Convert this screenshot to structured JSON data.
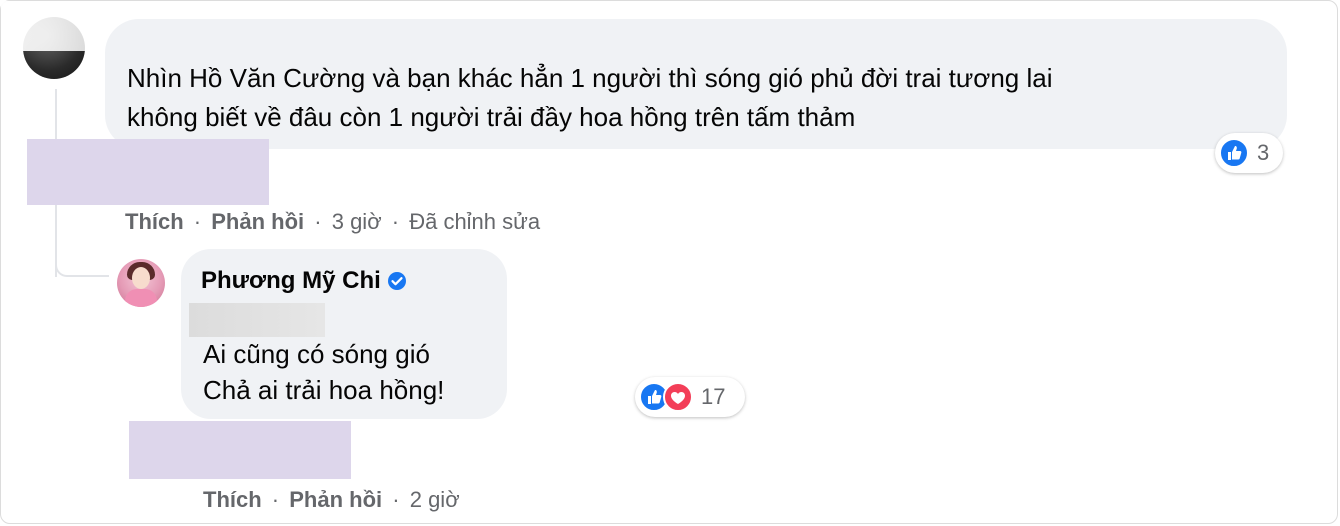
{
  "comment1": {
    "text_line1": "Nhìn Hồ Văn Cường và bạn khác hẳn 1 người thì sóng gió phủ đời trai tương lai",
    "text_line2": "không biết về đâu còn 1 người trải đầy hoa hồng trên tấm thảm",
    "reaction_count": "3",
    "reaction_icons": [
      "like-icon"
    ],
    "actions": {
      "like": "Thích",
      "reply": "Phản hồi",
      "time": "3 giờ",
      "edited": "Đã chỉnh sửa"
    }
  },
  "reply": {
    "author": "Phương Mỹ Chi",
    "verified": true,
    "text_line1": "Ai cũng có sóng gió",
    "text_line2": "Chả ai trải hoa hồng!",
    "reaction_count": "17",
    "reaction_icons": [
      "like-icon",
      "care-icon"
    ],
    "actions": {
      "like": "Thích",
      "reply": "Phản hồi",
      "time": "2 giờ"
    }
  },
  "separator": "·",
  "colors": {
    "bubble": "#f0f2f5",
    "like_blue": "#1877f2",
    "care_red": "#f33e58",
    "meta_text": "#65676b",
    "redaction_purple": "#ddd6eb"
  }
}
